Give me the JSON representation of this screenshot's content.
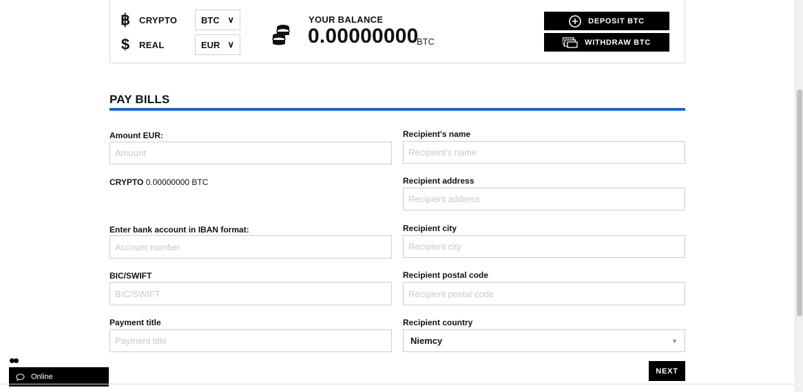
{
  "panel": {
    "crypto_label": "CRYPTO",
    "crypto_icon": "bitcoin-icon",
    "crypto_selected": "BTC",
    "real_label": "REAL",
    "real_icon": "dollar-icon",
    "real_selected": "EUR",
    "balance_label": "YOUR BALANCE",
    "balance_value": "0.00000000",
    "balance_unit": "BTC",
    "deposit_label": "DEPOSIT BTC",
    "withdraw_label": "WITHDRAW BTC"
  },
  "section": {
    "title": "PAY BILLS",
    "accent_color": "#1565d8"
  },
  "left_form": {
    "amount_label": "Amount EUR:",
    "amount_placeholder": "Amount",
    "crypto_strong": "CRYPTO",
    "crypto_value": "0.00000000 BTC",
    "iban_label": "Enter bank account in IBAN format:",
    "iban_placeholder": "Account number",
    "bic_label": "BIC/SWIFT",
    "bic_placeholder": "BIC/SWIFT",
    "title_label": "Payment title",
    "title_placeholder": "Payment title"
  },
  "right_form": {
    "name_label": "Recipient's name",
    "name_placeholder": "Recipient's name",
    "address_label": "Recipient address",
    "address_placeholder": "Recipient address",
    "city_label": "Recipient city",
    "city_placeholder": "Recipient city",
    "postal_label": "Recipient postal code",
    "postal_placeholder": "Recipient postal code",
    "country_label": "Recipient country",
    "country_selected": "Niemcy"
  },
  "next_label": "NEXT",
  "chat": {
    "status": "Online"
  }
}
